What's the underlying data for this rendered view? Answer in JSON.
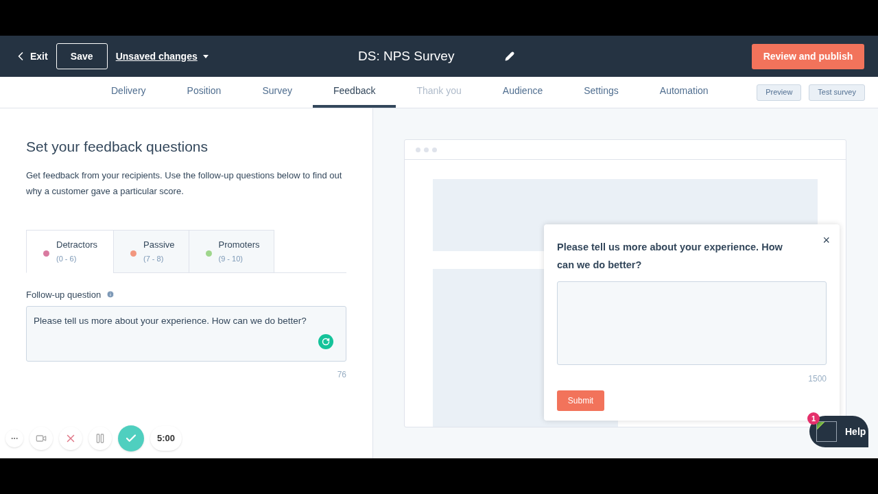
{
  "header": {
    "exit": "Exit",
    "save": "Save",
    "unsaved": "Unsaved changes",
    "title": "DS: NPS Survey",
    "publish": "Review and publish"
  },
  "nav_tabs": [
    {
      "label": "Delivery",
      "selected": false,
      "disabled": false
    },
    {
      "label": "Position",
      "selected": false,
      "disabled": false
    },
    {
      "label": "Survey",
      "selected": false,
      "disabled": false
    },
    {
      "label": "Feedback",
      "selected": true,
      "disabled": false
    },
    {
      "label": "Thank you",
      "selected": false,
      "disabled": true
    },
    {
      "label": "Audience",
      "selected": false,
      "disabled": false
    },
    {
      "label": "Settings",
      "selected": false,
      "disabled": false
    },
    {
      "label": "Automation",
      "selected": false,
      "disabled": false
    }
  ],
  "nav_buttons": [
    "Preview",
    "Test survey"
  ],
  "panel": {
    "heading": "Set your feedback questions",
    "description": "Get feedback from your recipients. Use the follow-up questions below to find out why a customer gave a particular score.",
    "score_tabs": [
      {
        "label": "Detractors",
        "range": "(0 - 6)",
        "color": "#d97aa0",
        "selected": true
      },
      {
        "label": "Passive",
        "range": "(7 - 8)",
        "color": "#f2977f",
        "selected": false
      },
      {
        "label": "Promoters",
        "range": "(9 - 10)",
        "color": "#9fd68c",
        "selected": false
      }
    ],
    "field_label": "Follow-up question",
    "field_value": "Please tell us more about your experience. How can we do better?",
    "char_count": "76"
  },
  "preview": {
    "question": "Please tell us more about your experience. How can we do better?",
    "char_count": "1500",
    "submit": "Submit",
    "close": "×"
  },
  "recorder": {
    "time": "5:00"
  },
  "help": {
    "label": "Help",
    "badge": "1"
  }
}
